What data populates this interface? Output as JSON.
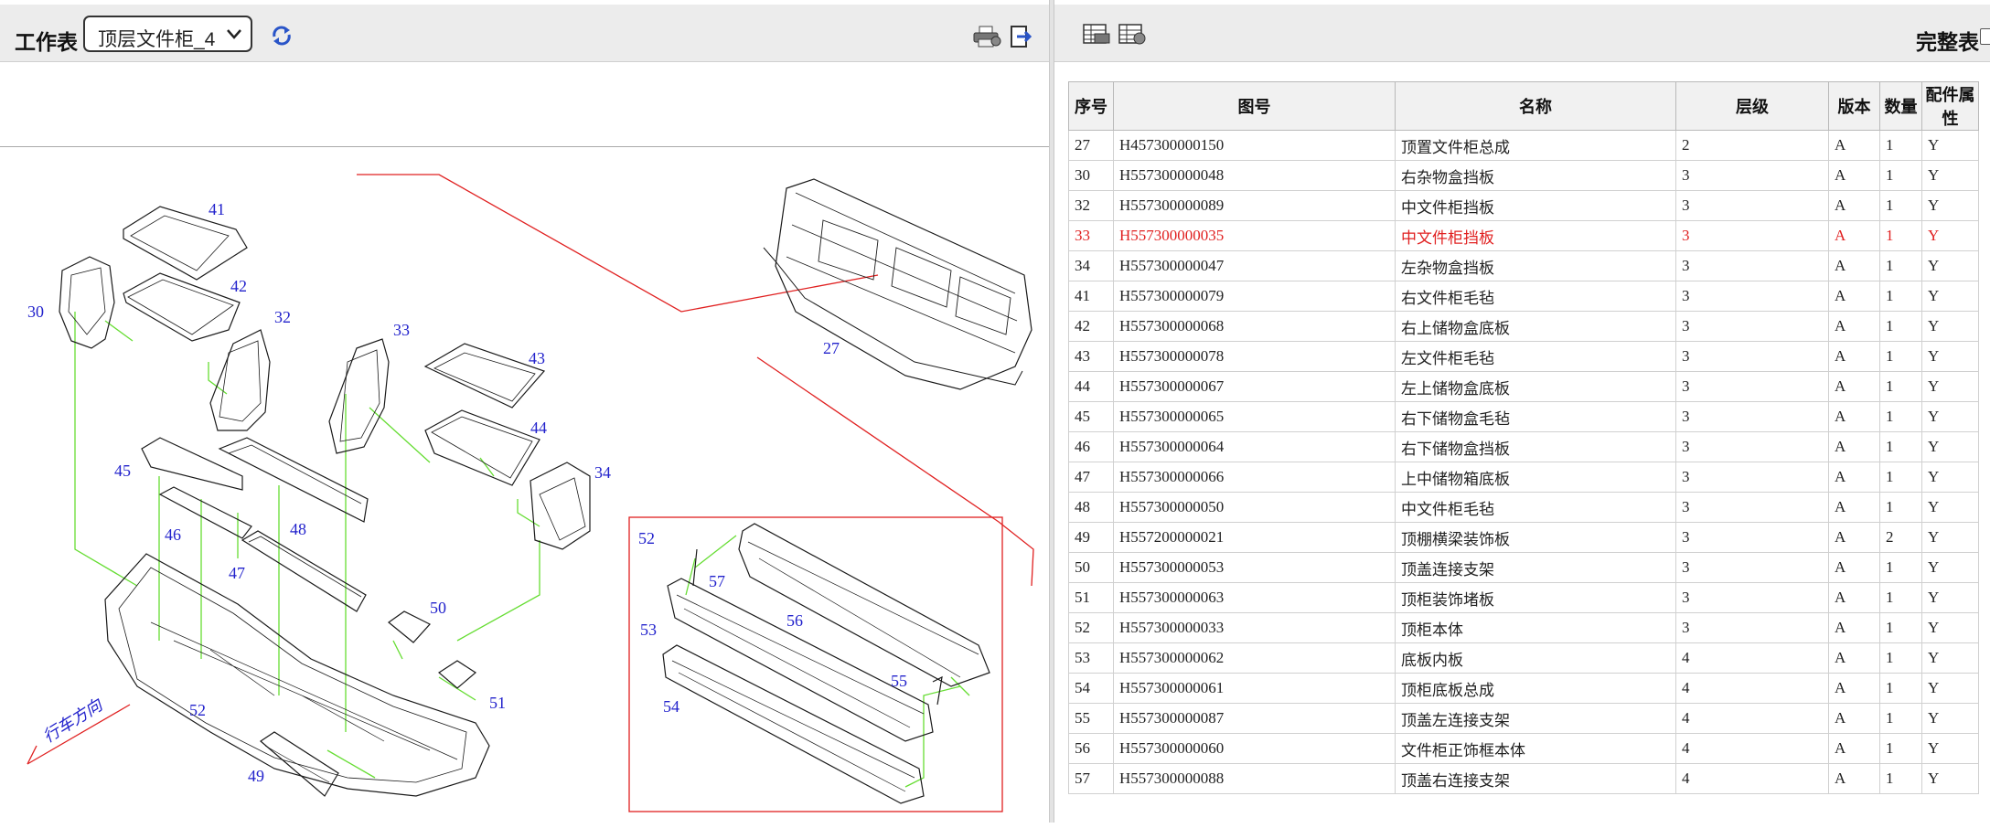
{
  "worksheet": {
    "label": "工作表",
    "selected": "顶层文件柜_4",
    "refresh_icon": "refresh-icon",
    "print_icon": "print-icon",
    "export_icon": "export-icon"
  },
  "drawing": {
    "callouts": [
      "41",
      "42",
      "30",
      "32",
      "33",
      "43",
      "44",
      "34",
      "45",
      "48",
      "46",
      "47",
      "50",
      "51",
      "52",
      "49",
      "27",
      "52",
      "57",
      "53",
      "56",
      "55",
      "54"
    ],
    "direction_label": "行车方向"
  },
  "bom": {
    "toolbar_icons": [
      "table-print-icon",
      "table-export-icon"
    ],
    "full_table_label": "完整表",
    "columns": [
      "序号",
      "图号",
      "名称",
      "层级",
      "版本",
      "数量",
      "配件属性"
    ],
    "selected_index": "33",
    "rows": [
      [
        "27",
        "H457300000150",
        "顶置文件柜总成",
        "2",
        "A",
        "1",
        "Y"
      ],
      [
        "30",
        "H557300000048",
        "右杂物盒挡板",
        "3",
        "A",
        "1",
        "Y"
      ],
      [
        "32",
        "H557300000089",
        "中文件柜挡板",
        "3",
        "A",
        "1",
        "Y"
      ],
      [
        "33",
        "H557300000035",
        "中文件柜挡板",
        "3",
        "A",
        "1",
        "Y"
      ],
      [
        "34",
        "H557300000047",
        "左杂物盒挡板",
        "3",
        "A",
        "1",
        "Y"
      ],
      [
        "41",
        "H557300000079",
        "右文件柜毛毡",
        "3",
        "A",
        "1",
        "Y"
      ],
      [
        "42",
        "H557300000068",
        "右上储物盒底板",
        "3",
        "A",
        "1",
        "Y"
      ],
      [
        "43",
        "H557300000078",
        "左文件柜毛毡",
        "3",
        "A",
        "1",
        "Y"
      ],
      [
        "44",
        "H557300000067",
        "左上储物盒底板",
        "3",
        "A",
        "1",
        "Y"
      ],
      [
        "45",
        "H557300000065",
        "右下储物盒毛毡",
        "3",
        "A",
        "1",
        "Y"
      ],
      [
        "46",
        "H557300000064",
        "右下储物盒挡板",
        "3",
        "A",
        "1",
        "Y"
      ],
      [
        "47",
        "H557300000066",
        "上中储物箱底板",
        "3",
        "A",
        "1",
        "Y"
      ],
      [
        "48",
        "H557300000050",
        "中文件柜毛毡",
        "3",
        "A",
        "1",
        "Y"
      ],
      [
        "49",
        "H557200000021",
        "顶棚横梁装饰板",
        "3",
        "A",
        "2",
        "Y"
      ],
      [
        "50",
        "H557300000053",
        "顶盖连接支架",
        "3",
        "A",
        "1",
        "Y"
      ],
      [
        "51",
        "H557300000063",
        "顶柜装饰堵板",
        "3",
        "A",
        "1",
        "Y"
      ],
      [
        "52",
        "H557300000033",
        "顶柜本体",
        "3",
        "A",
        "1",
        "Y"
      ],
      [
        "53",
        "H557300000062",
        "底板内板",
        "4",
        "A",
        "1",
        "Y"
      ],
      [
        "54",
        "H557300000061",
        "顶柜底板总成",
        "4",
        "A",
        "1",
        "Y"
      ],
      [
        "55",
        "H557300000087",
        "顶盖左连接支架",
        "4",
        "A",
        "1",
        "Y"
      ],
      [
        "56",
        "H557300000060",
        "文件柜正饰框本体",
        "4",
        "A",
        "1",
        "Y"
      ],
      [
        "57",
        "H557300000088",
        "顶盖右连接支架",
        "4",
        "A",
        "1",
        "Y"
      ]
    ]
  },
  "colors": {
    "selected_row": "#e02020",
    "callout": "#2222cc",
    "leader_red": "#e02020",
    "leader_green": "#66dd33"
  }
}
